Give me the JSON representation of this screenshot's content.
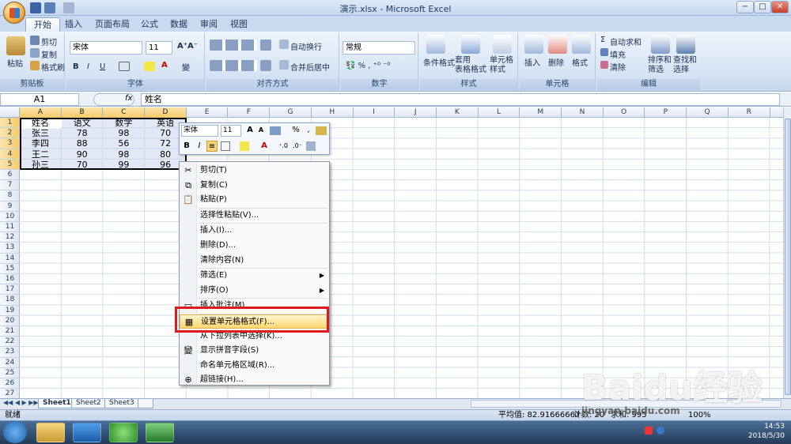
{
  "app": {
    "title": "演示.xlsx - Microsoft Excel"
  },
  "ribbon": {
    "tabs": [
      "开始",
      "插入",
      "页面布局",
      "公式",
      "数据",
      "审阅",
      "视图"
    ],
    "clipboard": {
      "paste": "粘贴",
      "cut": "剪切",
      "copy": "复制",
      "format_painter": "格式刷",
      "label": "剪贴板"
    },
    "font": {
      "name": "宋体",
      "size": "11",
      "label": "字体"
    },
    "alignment": {
      "wrap": "自动换行",
      "merge": "合并后居中",
      "label": "对齐方式"
    },
    "number": {
      "format": "常规",
      "label": "数字"
    },
    "styles": {
      "conditional": "条件格式",
      "table": "套用\n表格格式",
      "cell": "单元格\n样式",
      "label": "样式"
    },
    "cells": {
      "insert": "插入",
      "delete": "删除",
      "format": "格式",
      "label": "单元格"
    },
    "editing": {
      "autosum": "自动求和",
      "fill": "填充",
      "clear": "清除",
      "sort": "排序和\n筛选",
      "find": "查找和\n选择",
      "label": "编辑"
    }
  },
  "formula_bar": {
    "name_box": "A1",
    "fx": "fx",
    "content": "姓名"
  },
  "columns": [
    "A",
    "B",
    "C",
    "D",
    "E",
    "F",
    "G",
    "H",
    "I",
    "J",
    "K",
    "L",
    "M",
    "N",
    "O",
    "P",
    "Q",
    "R"
  ],
  "rows": [
    "1",
    "2",
    "3",
    "4",
    "5",
    "6",
    "7",
    "8",
    "9",
    "10",
    "11",
    "12",
    "13",
    "14",
    "15",
    "16",
    "17",
    "18",
    "19",
    "20",
    "21",
    "22",
    "23",
    "24",
    "25",
    "26",
    "27"
  ],
  "table": [
    [
      "姓名",
      "语文",
      "数学",
      "英语"
    ],
    [
      "张三",
      "78",
      "98",
      "70"
    ],
    [
      "李四",
      "88",
      "56",
      "72"
    ],
    [
      "王二",
      "90",
      "98",
      "80"
    ],
    [
      "孙三",
      "70",
      "99",
      "96"
    ]
  ],
  "mini_toolbar": {
    "font": "宋体",
    "size": "11",
    "percent": "%",
    "comma": ","
  },
  "context_menu": {
    "items": [
      {
        "label": "剪切(T)",
        "icon": "scissors-icon"
      },
      {
        "label": "复制(C)",
        "icon": "copy-icon"
      },
      {
        "label": "粘贴(P)",
        "icon": "paste-icon"
      },
      {
        "label": "选择性粘贴(V)..."
      },
      {
        "label": "插入(I)..."
      },
      {
        "label": "删除(D)..."
      },
      {
        "label": "清除内容(N)"
      },
      {
        "label": "筛选(E)",
        "submenu": true
      },
      {
        "label": "排序(O)",
        "submenu": true
      },
      {
        "label": "插入批注(M)",
        "icon": "comment-icon"
      },
      {
        "label": "设置单元格格式(F)...",
        "icon": "format-cells-icon"
      },
      {
        "label": "从下拉列表中选择(K)..."
      },
      {
        "label": "显示拼音字段(S)",
        "icon": "phonetic-icon"
      },
      {
        "label": "命名单元格区域(R)..."
      },
      {
        "label": "超链接(H)...",
        "icon": "hyperlink-icon"
      }
    ]
  },
  "sheets": [
    "Sheet1",
    "Sheet2",
    "Sheet3"
  ],
  "status": {
    "ready": "就绪",
    "average": "平均值: 82.91666667",
    "count": "计数: 20",
    "sum": "求和: 995",
    "zoom": "100%"
  },
  "taskbar": {
    "time": "14:53",
    "date": "2018/5/30"
  },
  "watermark": "Baidu经验",
  "watermark_sub": "jingyan.baidu.com"
}
